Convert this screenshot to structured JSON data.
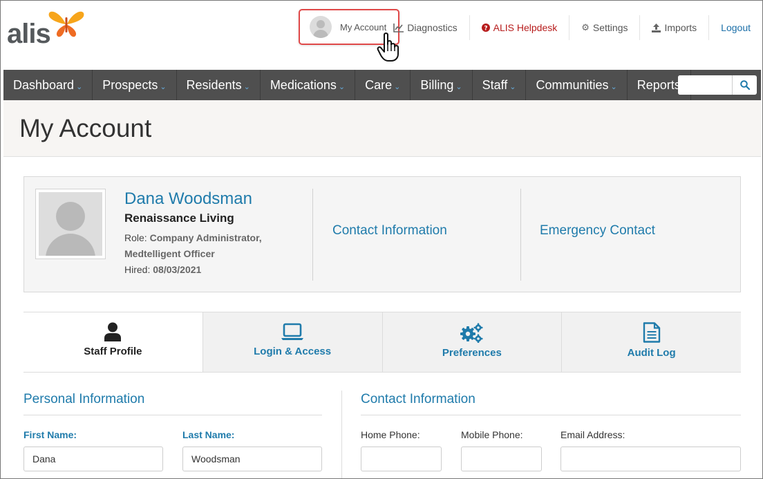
{
  "app": {
    "logo_text": "alis"
  },
  "toplinks": {
    "my_account": "My Account",
    "diagnostics": "Diagnostics",
    "helpdesk": "ALIS Helpdesk",
    "settings": "Settings",
    "imports": "Imports",
    "logout": "Logout"
  },
  "nav": {
    "items": [
      {
        "label": "Dashboard",
        "dropdown": true
      },
      {
        "label": "Prospects",
        "dropdown": true
      },
      {
        "label": "Residents",
        "dropdown": true
      },
      {
        "label": "Medications",
        "dropdown": true
      },
      {
        "label": "Care",
        "dropdown": true
      },
      {
        "label": "Billing",
        "dropdown": true
      },
      {
        "label": "Staff",
        "dropdown": true
      },
      {
        "label": "Communities",
        "dropdown": true
      },
      {
        "label": "Reports",
        "dropdown": false
      }
    ],
    "search_value": ""
  },
  "page": {
    "title": "My Account"
  },
  "profile": {
    "name": "Dana Woodsman",
    "organization": "Renaissance Living",
    "role_label": "Role:",
    "role_value": "Company Administrator, Medtelligent Officer",
    "hired_label": "Hired:",
    "hired_value": "08/03/2021",
    "contact_link": "Contact Information",
    "emergency_link": "Emergency Contact"
  },
  "tabs": [
    {
      "label": "Staff Profile",
      "icon": "user-icon",
      "active": true
    },
    {
      "label": "Login & Access",
      "icon": "laptop-icon",
      "active": false
    },
    {
      "label": "Preferences",
      "icon": "gears-icon",
      "active": false
    },
    {
      "label": "Audit Log",
      "icon": "document-icon",
      "active": false
    }
  ],
  "personal": {
    "title": "Personal Information",
    "first_name_label": "First Name:",
    "first_name_value": "Dana",
    "last_name_label": "Last Name:",
    "last_name_value": "Woodsman"
  },
  "contact": {
    "title": "Contact Information",
    "home_phone_label": "Home Phone:",
    "home_phone_value": "",
    "mobile_phone_label": "Mobile Phone:",
    "mobile_phone_value": "",
    "email_label": "Email Address:",
    "email_value": ""
  },
  "colors": {
    "accent": "#1f7bab",
    "nav_bg": "#4f4f4f",
    "highlight": "#e04848",
    "helpdesk": "#b71c1c"
  }
}
